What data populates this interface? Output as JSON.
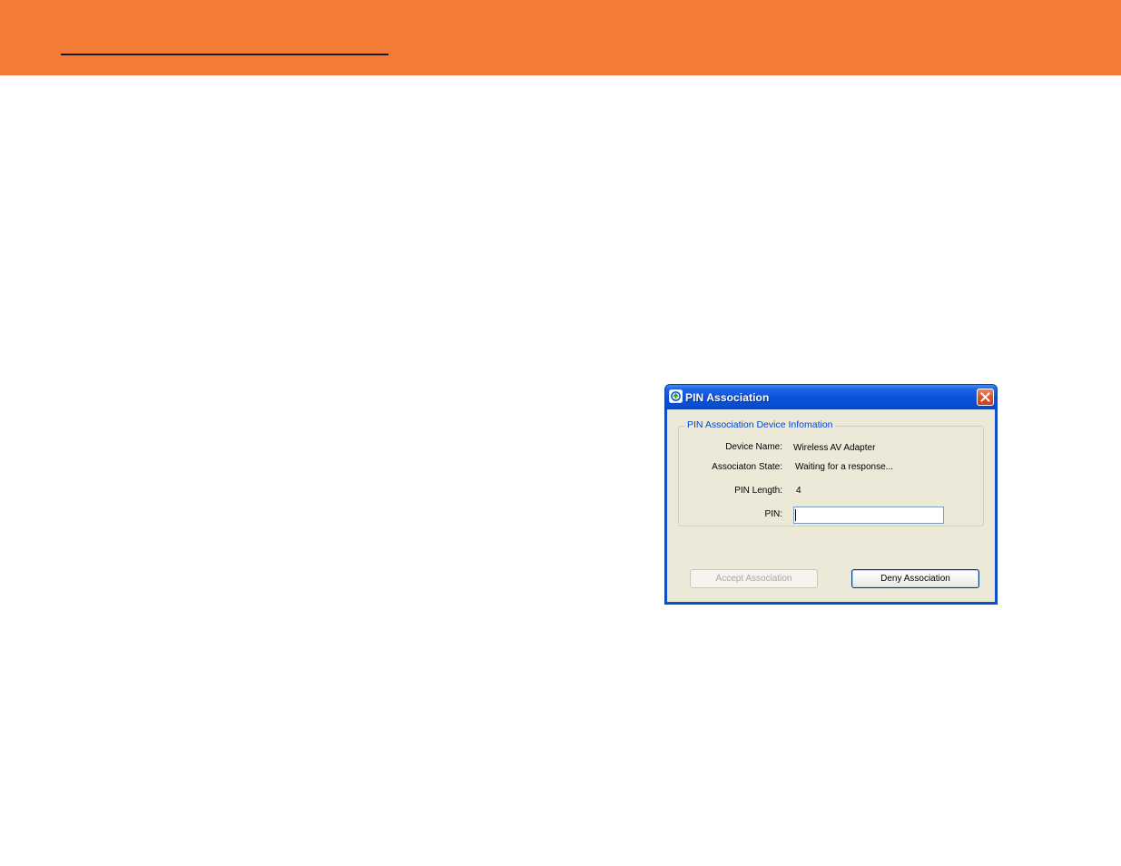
{
  "banner": {
    "color": "#f47b35"
  },
  "dialog": {
    "title": "PIN Association",
    "icon": "app-icon",
    "close_icon": "close-icon",
    "group": {
      "legend": "PIN Association Device Infomation",
      "fields": [
        {
          "label": "Device Name:",
          "value": "Wireless AV Adapter"
        },
        {
          "label": "Associaton State:",
          "value": "Waiting for a response..."
        },
        {
          "label": "PIN Length:",
          "value": "4"
        },
        {
          "label": "PIN:",
          "value": ""
        }
      ]
    },
    "buttons": {
      "accept": {
        "label": "Accept Association",
        "enabled": false
      },
      "deny": {
        "label": "Deny Association",
        "enabled": true
      }
    }
  }
}
